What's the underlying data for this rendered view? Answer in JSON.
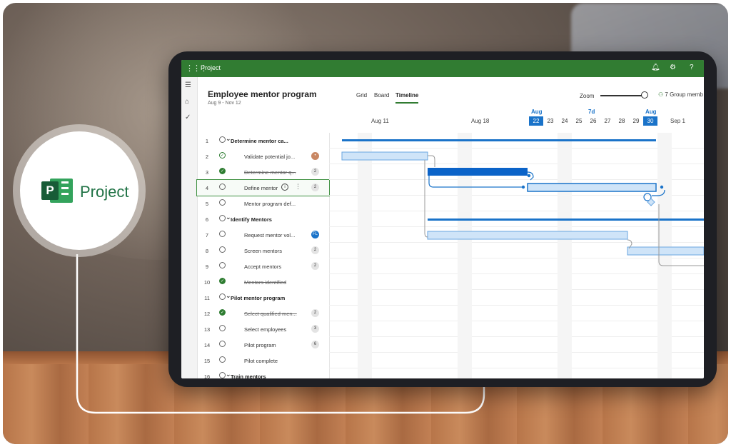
{
  "badge_logo": {
    "label": "Project",
    "mark_letter": "P",
    "brand_color": "#217346"
  },
  "app": {
    "name": "Project",
    "header_color": "#317c32"
  },
  "project": {
    "title": "Employee mentor program",
    "dates": "Aug 9 - Nov 12"
  },
  "views": [
    {
      "label": "Grid"
    },
    {
      "label": "Board"
    },
    {
      "label": "Timeline",
      "active": true
    }
  ],
  "zoom": {
    "label": "Zoom",
    "level": 0.9
  },
  "members": {
    "label": "7 Group memb"
  },
  "timeline": {
    "weeks": [
      "Aug 11",
      "Aug 18",
      "Sep 1"
    ],
    "month_label_1": "Aug",
    "duration_label": "7d",
    "month_label_2": "Aug",
    "days": [
      "22",
      "23",
      "24",
      "25",
      "26",
      "27",
      "28",
      "29",
      "30"
    ],
    "selected_days": [
      "22",
      "30"
    ],
    "accent": "#1a73c9"
  },
  "tasks": [
    {
      "n": "1",
      "name": "Determine mentor ca...",
      "summary": true,
      "status": "open"
    },
    {
      "n": "2",
      "name": "Validate potential jo...",
      "status": "progress",
      "assignee_avatar": true
    },
    {
      "n": "3",
      "name": "Determine mentor q...",
      "status": "done",
      "strike": true,
      "count": "2"
    },
    {
      "n": "4",
      "name": "Define mentor",
      "status": "open",
      "count": "2",
      "selected": true
    },
    {
      "n": "5",
      "name": "Mentor program def...",
      "status": "open"
    },
    {
      "n": "6",
      "name": "Identify Mentors",
      "summary": true,
      "status": "open"
    },
    {
      "n": "7",
      "name": "Request mentor vol...",
      "status": "open",
      "initials": "FL"
    },
    {
      "n": "8",
      "name": "Screen mentors",
      "status": "open",
      "count": "2"
    },
    {
      "n": "9",
      "name": "Accept mentors",
      "status": "open",
      "count": "2"
    },
    {
      "n": "10",
      "name": "Mentors identified",
      "status": "done",
      "strike": true
    },
    {
      "n": "11",
      "name": "Pilot mentor program",
      "summary": true,
      "status": "open"
    },
    {
      "n": "12",
      "name": "Select qualified men...",
      "status": "done",
      "strike": true,
      "count": "2"
    },
    {
      "n": "13",
      "name": "Select employees",
      "status": "open",
      "count": "3"
    },
    {
      "n": "14",
      "name": "Pilot program",
      "status": "open",
      "count": "6"
    },
    {
      "n": "15",
      "name": "Pilot complete",
      "status": "open"
    },
    {
      "n": "16",
      "name": "Train mentors",
      "summary": true,
      "status": "open"
    }
  ]
}
